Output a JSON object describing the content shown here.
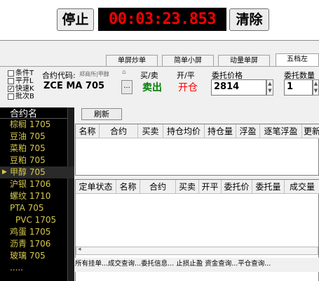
{
  "toolbar": {
    "stop_label": "停止",
    "timer": "00:03:23.853",
    "clear_label": "清除"
  },
  "tabs": [
    {
      "label": "单屏炒单"
    },
    {
      "label": "简单小屏"
    },
    {
      "label": "动量单屏"
    },
    {
      "label": "五档左"
    }
  ],
  "options": {
    "items": [
      "条件T",
      "平开L",
      "快速K",
      "批次B"
    ],
    "checked": [
      false,
      false,
      true,
      false
    ]
  },
  "order": {
    "contract_label": "合约代码:",
    "contract_hint": "郑商所|甲醇",
    "contract_value": "ZCE MA 705",
    "buysell_label": "买/卖",
    "buysell_value": "卖出",
    "openclose_label": "开/平",
    "openclose_value": "开仓",
    "price_label": "委托价格",
    "price_value": "2814",
    "qty_label": "委托数量",
    "qty_value": "1",
    "browse_label": "..."
  },
  "contracts": {
    "header": "合约名",
    "items": [
      "棕榈 1705",
      "豆油 705",
      "菜粕 705",
      "豆粕 705",
      "甲醇 705",
      "沪银 1706",
      "螺纹 1710",
      "PTA 705",
      "PVC 1705",
      "鸡蛋 1705",
      "沥青 1706",
      "玻璃 705",
      "....."
    ],
    "selected_index": 4
  },
  "refresh_label": "刷新",
  "positions": {
    "columns": [
      "名称",
      "合约",
      "买卖",
      "持仓均价",
      "持仓量",
      "浮盈",
      "逐笔浮盈",
      "更新"
    ]
  },
  "orders": {
    "columns": [
      "定单状态",
      "名称",
      "合约",
      "买卖",
      "开平",
      "委托价",
      "委托量",
      "成交量"
    ]
  },
  "bottom_bar": {
    "text": "所有挂单...成交查询...委托信息... 止损止盈 资金查询...平仓查询..."
  },
  "colors": {
    "timer_bg": "#000000",
    "timer_fg": "#ff0000",
    "sell": "#008000",
    "open": "#ff0000",
    "contract_text": "#d6c84a"
  }
}
